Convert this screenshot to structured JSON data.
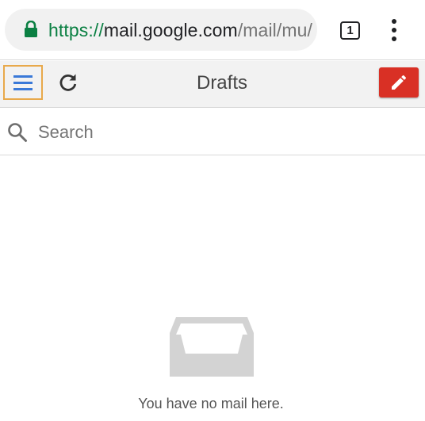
{
  "browser": {
    "url_scheme": "https://",
    "url_host": "mail.google.com",
    "url_path": "/mail/mu/",
    "tab_count": "1",
    "icons": [
      "lock-icon",
      "tab-switcher-icon",
      "more-vert-icon"
    ]
  },
  "toolbar": {
    "title": "Drafts",
    "icons": [
      "menu-icon",
      "refresh-icon",
      "compose-pencil-icon"
    ],
    "compose_color": "#d93025",
    "menu_icon_color": "#3a79d8"
  },
  "search": {
    "placeholder": "Search",
    "value": ""
  },
  "empty_state": {
    "message": "You have no mail here.",
    "icon": "inbox-tray-icon"
  }
}
